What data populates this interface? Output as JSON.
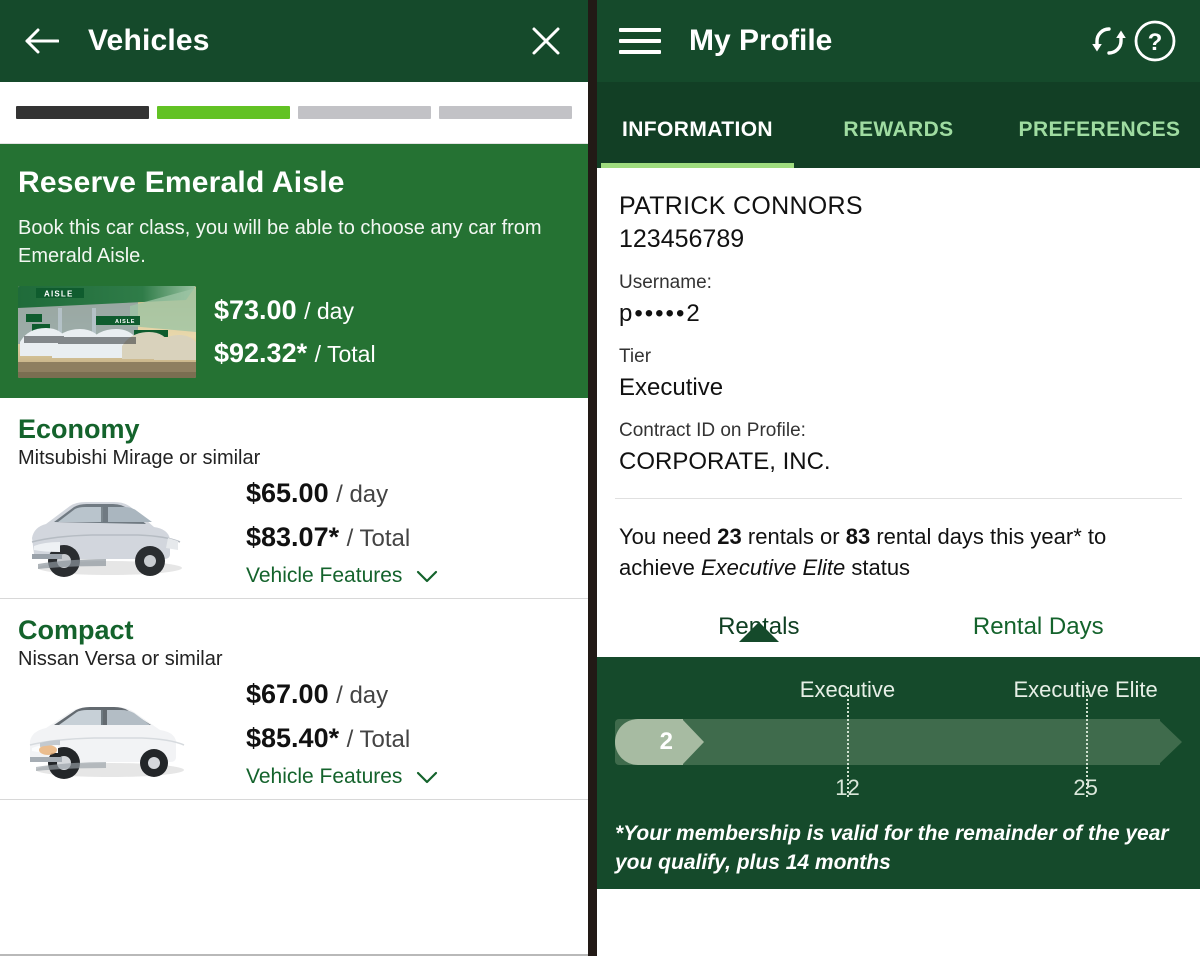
{
  "left": {
    "header": {
      "back_icon": "back-arrow-icon",
      "title": "Vehicles",
      "close_icon": "close-x-icon"
    },
    "progress_steps": [
      {
        "state": "done"
      },
      {
        "state": "active"
      },
      {
        "state": "todo"
      },
      {
        "state": "todo"
      }
    ],
    "promo": {
      "title": "Reserve Emerald Aisle",
      "description": "Book this car class, you will be able to choose any car from Emerald Aisle.",
      "thumb_sign": "AISLE",
      "day_amount": "$73.00",
      "day_unit": "/ day",
      "total_amount": "$92.32*",
      "total_unit": "/ Total"
    },
    "vehicles": [
      {
        "class": "Economy",
        "model": "Mitsubishi Mirage or similar",
        "day_amount": "$65.00",
        "day_unit": "/ day",
        "total_amount": "$83.07*",
        "total_unit": "/ Total",
        "features_label": "Vehicle Features"
      },
      {
        "class": "Compact",
        "model": "Nissan Versa or similar",
        "day_amount": "$67.00",
        "day_unit": "/ day",
        "total_amount": "$85.40*",
        "total_unit": "/ Total",
        "features_label": "Vehicle Features"
      }
    ]
  },
  "right": {
    "header": {
      "menu_icon": "hamburger-menu-icon",
      "title": "My Profile",
      "sync_icon": "sync-icon",
      "help_icon": "help-circle-icon"
    },
    "tabs": [
      {
        "label": "INFORMATION",
        "active": true
      },
      {
        "label": "REWARDS",
        "active": false
      },
      {
        "label": "PREFERENCES",
        "active": false
      }
    ],
    "profile": {
      "name": "PATRICK CONNORS",
      "member_number": "123456789",
      "username_label": "Username:",
      "username_value": "p•••••2",
      "tier_label": "Tier",
      "tier_value": "Executive",
      "contract_label": "Contract ID on Profile:",
      "contract_value": "CORPORATE, INC."
    },
    "status": {
      "prefix": "You need ",
      "rentals_needed": "23",
      "middle": " rentals or ",
      "days_needed": "83",
      "suffix": " rental days this year* to achieve ",
      "target_tier": "Executive Elite",
      "end": " status"
    },
    "toggle": {
      "rentals_label": "Rentals",
      "rental_days_label": "Rental Days",
      "selected": "Rentals"
    },
    "progress": {
      "current_value": "2",
      "tier_1_label": "Executive",
      "tier_1_value": "12",
      "tier_2_label": "Executive Elite",
      "tier_2_value": "25",
      "footnote": "*Your membership is valid for the remainder of the year you qualify, plus 14 months"
    }
  },
  "colors": {
    "header_green": "#154a2b",
    "promo_green": "#257233",
    "accent_green": "#14632c",
    "step_active": "#62c224",
    "bar_fill": "#a7bba2"
  }
}
